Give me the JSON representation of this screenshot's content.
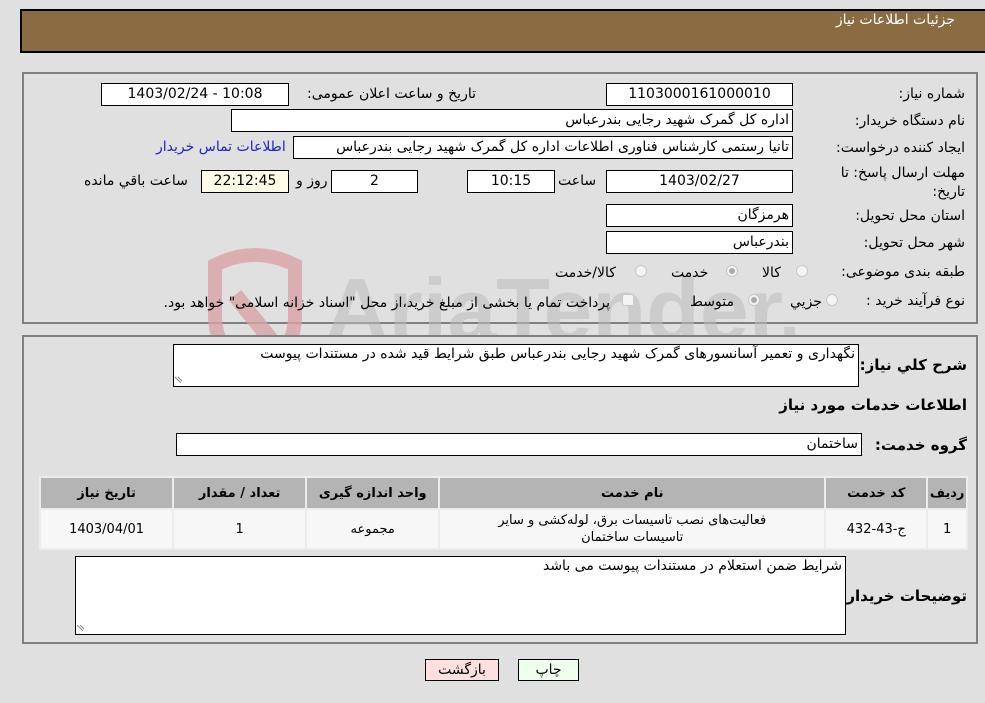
{
  "header": {
    "title": "جزئیات اطلاعات نیاز"
  },
  "details": {
    "need_number": {
      "label": "شماره نیاز:",
      "value": "1103000161000010"
    },
    "announce_datetime": {
      "label": "تاریخ و ساعت اعلان عمومی:",
      "value": "1403/02/24 - 10:08"
    },
    "buyer_org": {
      "label": "نام دستگاه خریدار:",
      "value": "اداره کل گمرک شهید رجایی بندرعباس"
    },
    "requester": {
      "label": "ایجاد کننده درخواست:",
      "value": "تانیا رستمی کارشناس فناوری اطلاعات اداره کل گمرک شهید رجایی بندرعباس"
    },
    "buyer_contact_link": "اطلاعات تماس خریدار",
    "deadline": {
      "label": "مهلت ارسال پاسخ: تا تاریخ:",
      "date": "1403/02/27",
      "time_label": "ساعت",
      "time": "10:15",
      "days": "2",
      "days_label": "روز و",
      "remaining": "22:12:45",
      "remaining_label": "ساعت باقي مانده"
    },
    "province": {
      "label": "استان محل تحویل:",
      "value": "هرمزگان"
    },
    "city": {
      "label": "شهر محل تحویل:",
      "value": "بندرعباس"
    },
    "category": {
      "label": "طبقه بندی موضوعی:",
      "options": [
        "کالا",
        "خدمت",
        "کالا/خدمت"
      ],
      "selected": "خدمت"
    },
    "purchase_type": {
      "label": "نوع فرآیند خرید :",
      "options": [
        "جزیي",
        "متوسط"
      ],
      "selected": "متوسط",
      "treasury_note": "پرداخت تمام یا بخشی از مبلغ خرید،از محل \"اسناد خزانه اسلامی\" خواهد بود."
    }
  },
  "summary": {
    "label": "شرح کلي نیاز:",
    "value": "نگهداری و تعمیر آسانسورهای گمرک شهید رجایی بندرعباس طبق شرایط قید شده در مستندات پیوست"
  },
  "services_section_title": "اطلاعات خدمات مورد نیاز",
  "service_group": {
    "label": "گروه خدمت:",
    "value": "ساختمان"
  },
  "table": {
    "headers": [
      "ردیف",
      "کد خدمت",
      "نام خدمت",
      "واحد اندازه گیری",
      "تعداد / مقدار",
      "تاریخ نیاز"
    ],
    "rows": [
      [
        "1",
        "ج-43-432",
        "فعالیت‌های نصب تاسیسات برق، لوله‌کشی و سایر تاسیسات ساختمان",
        "مجموعه",
        "1",
        "1403/04/01"
      ]
    ]
  },
  "buyer_notes": {
    "label": "توضیحات خریدار:",
    "value": "شرایط ضمن استعلام در مستندات پیوست می باشد"
  },
  "buttons": {
    "print": "چاپ",
    "back": "بازگشت"
  },
  "watermark": "AriaTender.net",
  "colors": {
    "header_bg": "#8b6c42",
    "link": "#2323c8",
    "print_btn": "#eeffee",
    "back_btn": "#ffe0e0"
  }
}
